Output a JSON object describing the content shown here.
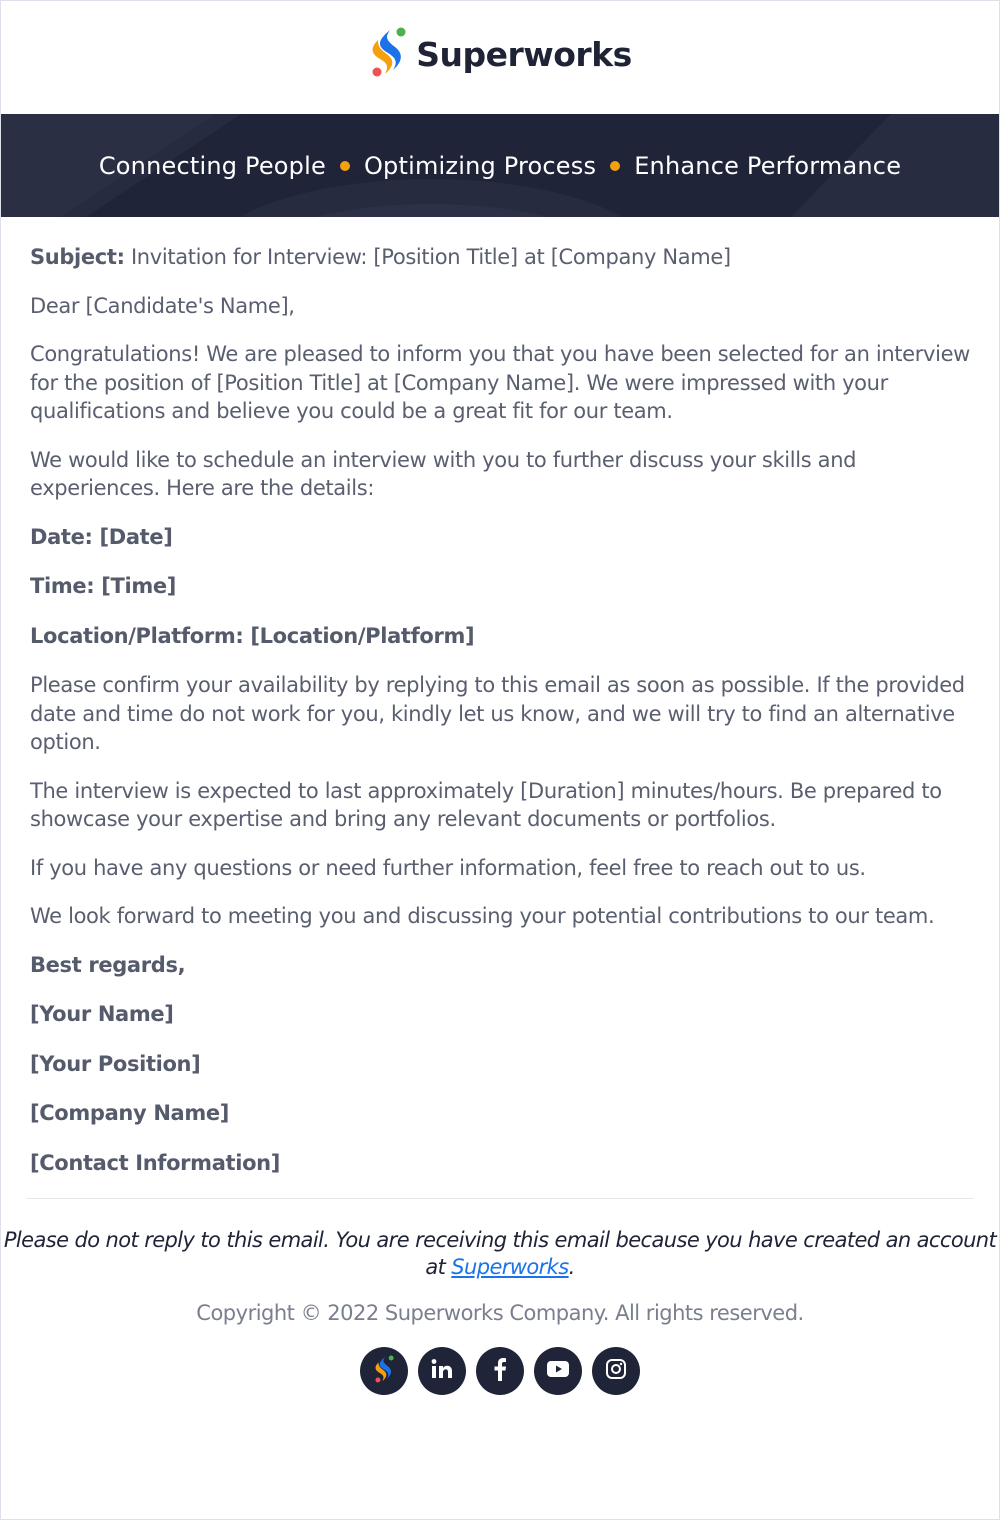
{
  "header": {
    "brand_name": "Superworks",
    "logo_icon": "superworks-logo-icon"
  },
  "banner": {
    "taglines": [
      "Connecting People",
      "Optimizing Process",
      "Enhance Performance"
    ],
    "separator_color": "#f5a00f",
    "background_color": "#1f2438"
  },
  "email": {
    "subject_label": "Subject:",
    "subject_text": " Invitation for Interview: [Position Title] at [Company Name]",
    "greeting": "Dear [Candidate's Name],",
    "paragraphs": [
      "Congratulations! We are pleased to inform you that you have been selected for an interview for the position of [Position Title] at [Company Name]. We were impressed with your qualifications and believe you could be a great fit for our team.",
      "We would like to schedule an interview with you to further discuss your skills and experiences. Here are the details:"
    ],
    "details": [
      "Date: [Date]",
      "Time: [Time]",
      "Location/Platform: [Location/Platform]"
    ],
    "paragraphs_after": [
      "Please confirm your availability by replying to this email as soon as possible. If the provided date and time do not work for you, kindly let us know, and we will try to find an alternative option.",
      "The interview is expected to last approximately [Duration] minutes/hours. Be prepared to showcase your expertise and bring any relevant documents or portfolios.",
      "If you have any questions or need further information, feel free to reach out to us.",
      "We look forward to meeting you and discussing your potential contributions to our team."
    ],
    "signature": [
      "Best regards,",
      "[Your Name]",
      "[Your Position]",
      "[Company Name]",
      "[Contact Information]"
    ]
  },
  "footer": {
    "note_part1": "Please do not reply to this email. You are receiving this email because you have created an account at ",
    "note_link": "Superworks",
    "note_part2": ".",
    "link_color": "#1a73e8",
    "copyright": "Copyright © 2022 Superworks Company. All rights reserved.",
    "socials": [
      {
        "name": "superworks",
        "icon": "superworks-icon"
      },
      {
        "name": "linkedin",
        "icon": "linkedin-icon"
      },
      {
        "name": "facebook",
        "icon": "facebook-icon"
      },
      {
        "name": "youtube",
        "icon": "youtube-icon"
      },
      {
        "name": "instagram",
        "icon": "instagram-icon"
      }
    ]
  }
}
